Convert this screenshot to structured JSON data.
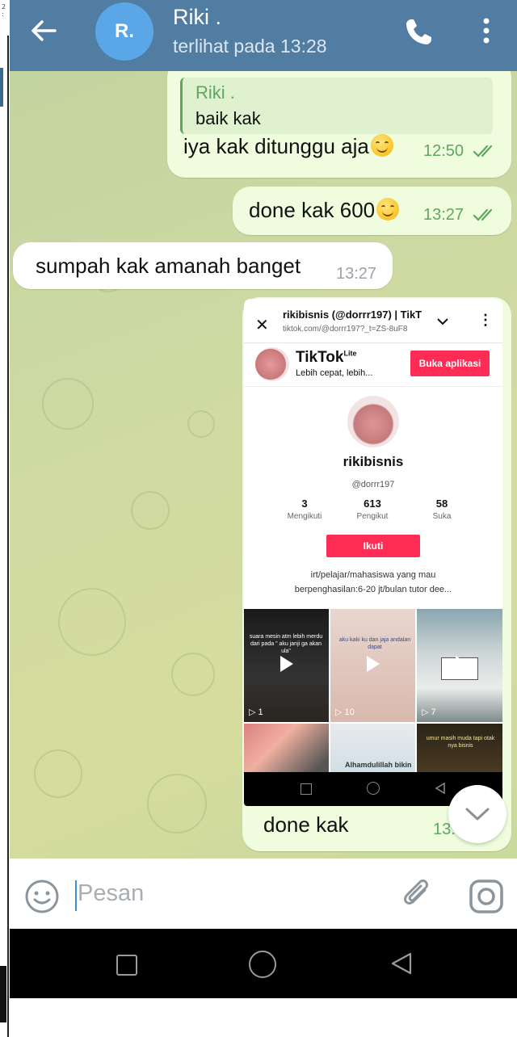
{
  "header": {
    "back_icon": "arrow-left-icon",
    "avatar_initials": "R.",
    "avatar_color": "#5aa6e6",
    "title": "Riki .",
    "status": "terlihat pada  13:28",
    "call_icon": "phone-icon",
    "more_icon": "more-vertical-icon",
    "bar_color": "#517da2"
  },
  "messages": [
    {
      "direction": "out",
      "reply_name": "Riki .",
      "reply_text": "baik kak",
      "text": "iya kak ditunggu aja",
      "emoji": "smiling-face-emoji",
      "time": "12:50",
      "read": true
    },
    {
      "direction": "out",
      "text": "done kak 600",
      "emoji": "smiling-face-emoji",
      "time": "13:27",
      "read": true
    },
    {
      "direction": "in",
      "text": "sumpah kak amanah banget",
      "time": "13:27"
    },
    {
      "direction": "out",
      "caption": "done kak",
      "time": "13:2",
      "screenshot": {
        "page_title": "rikibisnis (@dorrr197) | TikT",
        "page_url": "tiktok.com/@dorrr197?_t=ZS-8uF8",
        "app_name": "TikTok",
        "app_badge": "Lite",
        "app_tagline": "Lebih cepat, lebih...",
        "open_app_button": "Buka aplikasi",
        "username": "rikibisnis",
        "handle": "@dorrr197",
        "stats": [
          {
            "value": "3",
            "label": "Mengikuti"
          },
          {
            "value": "613",
            "label": "Pengikut"
          },
          {
            "value": "58",
            "label": "Suka"
          }
        ],
        "follow_button": "Ikuti",
        "bio_line1": "irt/pelajar/mahasiswa yang mau",
        "bio_line2": "berpenghasilan:6-20 jt/bulan tutor dee...",
        "videos": [
          {
            "views": "▷ 1"
          },
          {
            "views": "▷ 10"
          },
          {
            "views": "▷ 7"
          },
          {
            "caption": "Alhamdulillah bikin"
          }
        ]
      }
    }
  ],
  "scroll_down_icon": "chevron-down-icon",
  "input": {
    "placeholder": "Pesan",
    "emoji_icon": "smile-icon",
    "attach_icon": "paperclip-icon",
    "camera_icon": "instagram-camera-icon"
  },
  "colors": {
    "outgoing_bubble": "#effdde",
    "incoming_bubble": "#ffffff",
    "tick_green": "#5fa760",
    "tiktok_red": "#fe2c55"
  }
}
